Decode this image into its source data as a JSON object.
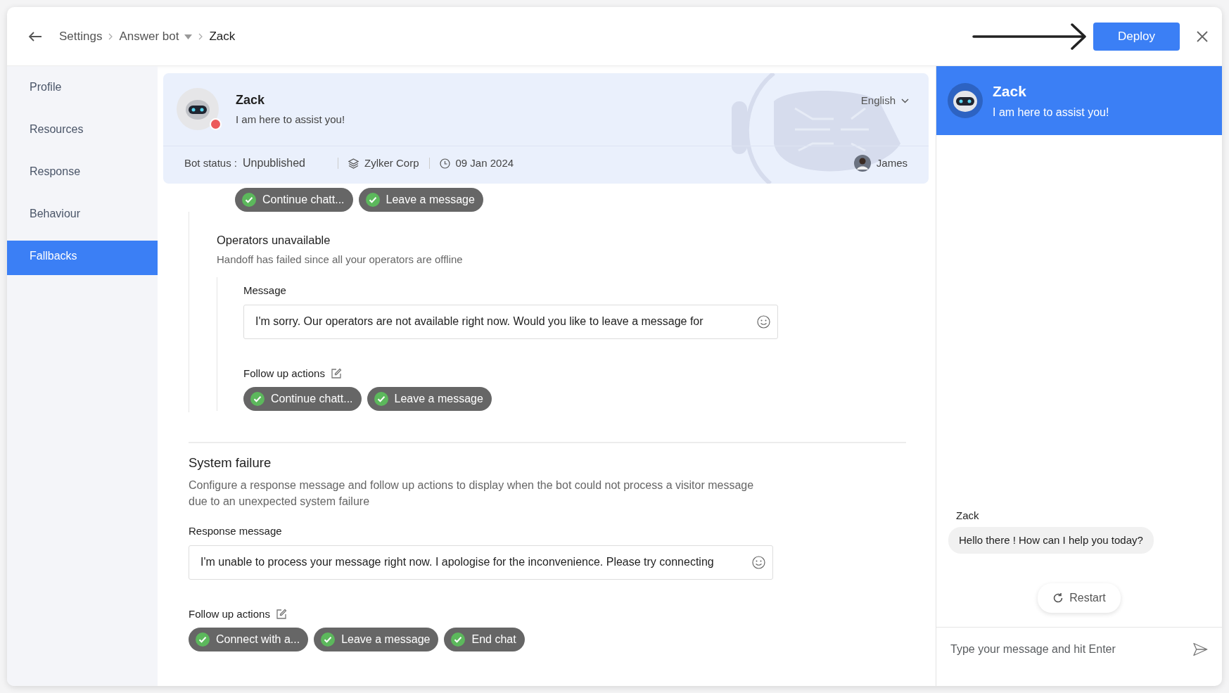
{
  "header": {
    "breadcrumb": [
      {
        "label": "Settings",
        "kind": "link"
      },
      {
        "label": "Answer bot",
        "kind": "dropdown"
      },
      {
        "label": "Zack",
        "kind": "current"
      }
    ],
    "deploy": "Deploy"
  },
  "sidebar": {
    "items": [
      {
        "label": "Profile",
        "selected": false
      },
      {
        "label": "Resources",
        "selected": false
      },
      {
        "label": "Response",
        "selected": false
      },
      {
        "label": "Behaviour",
        "selected": false
      },
      {
        "label": "Fallbacks",
        "selected": true
      }
    ]
  },
  "bot_card": {
    "name": "Zack",
    "tagline": "I am here to assist you!",
    "online": false,
    "language": "English",
    "status_label": "Bot status :",
    "status": "Unpublished",
    "company": "Zylker Corp",
    "date": "09 Jan 2024",
    "owner": "James"
  },
  "previous_actions": [
    {
      "label": "Continue chatt...",
      "checked": true
    },
    {
      "label": "Leave a message",
      "checked": true
    }
  ],
  "operators_unavailable": {
    "title": "Operators unavailable",
    "description": "Handoff has failed since all your operators are offline",
    "message_label": "Message",
    "message": "I'm sorry. Our operators are not available right now. Would you like to leave a message for",
    "follow_up_label": "Follow up actions",
    "actions": [
      {
        "label": "Continue chatt...",
        "checked": true
      },
      {
        "label": "Leave a message",
        "checked": true
      }
    ]
  },
  "system_failure": {
    "title": "System failure",
    "description": "Configure a response message and follow up actions to display when the bot could not process a visitor message due to an unexpected system failure",
    "message_label": "Response message",
    "message": "I'm unable to process your message right now. I apologise for the inconvenience. Please try connecting",
    "follow_up_label": "Follow up actions",
    "actions": [
      {
        "label": "Connect with a...",
        "checked": true
      },
      {
        "label": "Leave a message",
        "checked": true
      },
      {
        "label": "End chat",
        "checked": true
      }
    ]
  },
  "chat_preview": {
    "name": "Zack",
    "tagline": "I am here to assist you!",
    "messages": [
      {
        "sender": "Zack",
        "text": "Hello there ! How can I help you today?"
      }
    ],
    "restart": "Restart",
    "placeholder": "Type your message and hit Enter"
  }
}
